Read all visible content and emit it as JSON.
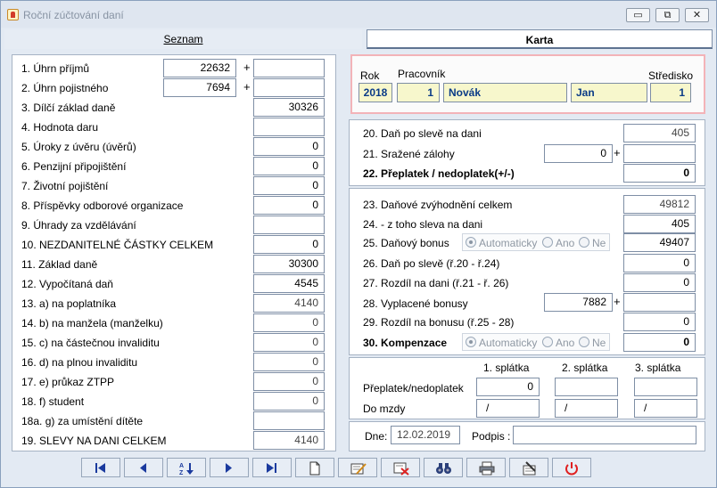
{
  "window": {
    "title": "Roční zúčtování daní",
    "buttons": [
      "▭",
      "⧉",
      "✕"
    ]
  },
  "tabs": {
    "seznam": "Seznam",
    "karta": "Karta"
  },
  "left": {
    "r1": {
      "label": "1. Úhrn příjmů",
      "value": "22632",
      "extra": ""
    },
    "r2": {
      "label": "2. Úhrn pojistného",
      "value": "7694",
      "extra": ""
    },
    "r3": {
      "label": "3. Dílčí základ daně",
      "value": "30326"
    },
    "r4": {
      "label": "4. Hodnota daru",
      "value": ""
    },
    "r5": {
      "label": "5. Úroky z úvěru (úvěrů)",
      "value": "0"
    },
    "r6": {
      "label": "6. Penzijní připojištění",
      "value": "0"
    },
    "r7": {
      "label": "7. Životní pojištění",
      "value": "0"
    },
    "r8": {
      "label": "8. Příspěvky odborové organizace",
      "value": "0"
    },
    "r9": {
      "label": "9. Úhrady za vzdělávání",
      "value": ""
    },
    "r10": {
      "label": "10. NEZDANITELNÉ ČÁSTKY CELKEM",
      "value": "0"
    },
    "r11": {
      "label": "11. Základ daně",
      "value": "30300"
    },
    "r12": {
      "label": "12. Vypočítaná daň",
      "value": "4545"
    },
    "r13": {
      "label": "13. a) na  poplatníka",
      "value": "4140"
    },
    "r14": {
      "label": "14. b) na manžela (manželku)",
      "value": "0"
    },
    "r15": {
      "label": "15. c) na částečnou invaliditu",
      "value": "0"
    },
    "r16": {
      "label": "16. d) na plnou invaliditu",
      "value": "0"
    },
    "r17": {
      "label": "17. e) průkaz ZTPP",
      "value": "0"
    },
    "r18": {
      "label": "18. f) student",
      "value": "0"
    },
    "r18a": {
      "label": "18a. g) za umístění dítěte",
      "value": ""
    },
    "r19": {
      "label": "19. SLEVY NA DANI CELKEM",
      "value": "4140"
    },
    "plus": "+"
  },
  "header": {
    "rok_label": "Rok",
    "pracovnik_label": "Pracovník",
    "stredisko_label": "Středisko",
    "rok": "2018",
    "osc": "1",
    "prijmeni": "Novák",
    "jmeno": "Jan",
    "stredisko": "1"
  },
  "right": {
    "r20": {
      "label": "20. Daň po slevě na dani",
      "value": "405"
    },
    "r21": {
      "label": "21. Sražené zálohy",
      "value": "0",
      "extra": ""
    },
    "r22": {
      "label": "22. Přeplatek / nedoplatek(+/-)",
      "value": "0"
    },
    "r23": {
      "label": "23. Daňové zvýhodnění celkem",
      "value": "49812"
    },
    "r24": {
      "label": "24. - z toho sleva na dani",
      "value": "405"
    },
    "r25": {
      "label": "25. Daňový bonus",
      "value": "49407"
    },
    "r26": {
      "label": "26. Daň po slevě (ř.20 - ř.24)",
      "value": "0"
    },
    "r27": {
      "label": "27. Rozdíl na dani (ř.21 - ř. 26)",
      "value": "0"
    },
    "r28": {
      "label": "28. Vyplacené bonusy",
      "value": "7882",
      "extra": ""
    },
    "r29": {
      "label": "29. Rozdíl na bonusu (ř.25 - 28)",
      "value": "0"
    },
    "r30": {
      "label": "30. Kompenzace",
      "value": "0"
    },
    "radio": {
      "auto": "Automaticky",
      "ano": "Ano",
      "ne": "Ne"
    },
    "plus": "+"
  },
  "splatky": {
    "h1": "1. splátka",
    "h2": "2. splátka",
    "h3": "3. splátka",
    "row1": "Přeplatek/nedoplatek",
    "row2": "Do mzdy",
    "p1": "0",
    "p2": "",
    "p3": "",
    "m1": "/",
    "m2": "/",
    "m3": "/"
  },
  "bottom": {
    "dne_label": "Dne:",
    "dne": "12.02.2019",
    "podpis_label": "Podpis :",
    "podpis": ""
  },
  "colors": {
    "accent": "#0a3b87",
    "highlight": "#f7f7cc",
    "header_border": "#f3b3b8"
  }
}
